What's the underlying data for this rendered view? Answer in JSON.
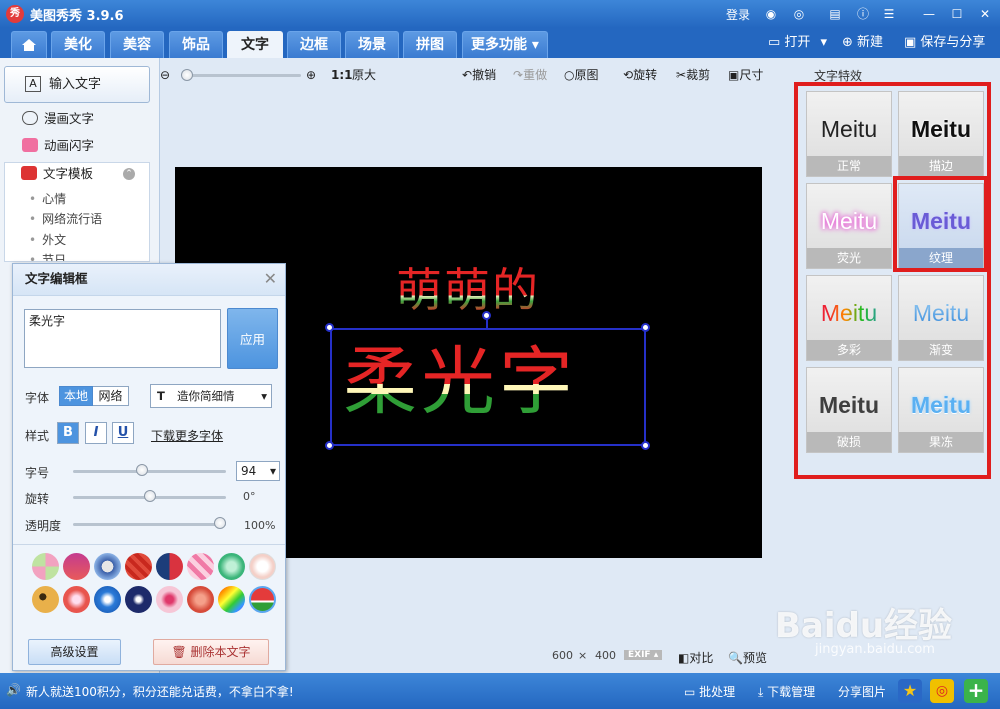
{
  "titlebar": {
    "title": "美图秀秀 3.9.6",
    "login": "登录"
  },
  "tabs": [
    {
      "label": "美化"
    },
    {
      "label": "美容"
    },
    {
      "label": "饰品"
    },
    {
      "label": "文字"
    },
    {
      "label": "边框"
    },
    {
      "label": "场景"
    },
    {
      "label": "拼图"
    },
    {
      "label": "更多功能"
    }
  ],
  "header_actions": {
    "open": "打开",
    "new": "新建",
    "save": "保存与分享"
  },
  "left_panel": {
    "input_text": "输入文字",
    "comic_text": "漫画文字",
    "anim_text": "动画闪字",
    "template": "文字模板",
    "template_items": [
      "心情",
      "网络流行语",
      "外文",
      "节日"
    ]
  },
  "toolbar": {
    "ratio": "1:1",
    "original_size": "原大",
    "undo": "撤销",
    "redo": "重做",
    "original_image": "原图",
    "rotate": "旋转",
    "crop": "裁剪",
    "dimensions": "尺寸"
  },
  "canvas": {
    "line1": "萌萌的",
    "line2": "柔光字"
  },
  "text_editor": {
    "title": "文字编辑框",
    "text_value": "柔光字",
    "apply": "应用",
    "font_label": "字体",
    "font_local": "本地",
    "font_web": "网络",
    "font_selected": "造你简细情",
    "style_label": "样式",
    "bold": "B",
    "italic": "I",
    "underline": "U",
    "more_fonts": "下载更多字体",
    "size_label": "字号",
    "size_value": "94",
    "size_fraction": 0.45,
    "rotate_label": "旋转",
    "rotate_value": "0°",
    "rotate_fraction": 0.5,
    "opacity_label": "透明度",
    "opacity_value": "100%",
    "opacity_fraction": 1.0,
    "advanced": "高级设置",
    "delete": "删除本文字"
  },
  "effects": {
    "title": "文字特效",
    "items": [
      {
        "word": "Meitu",
        "label": "正常"
      },
      {
        "word": "Meitu",
        "label": "描边"
      },
      {
        "word": "Meitu",
        "label": "荧光"
      },
      {
        "word": "Meitu",
        "label": "纹理"
      },
      {
        "word": "Meitu",
        "label": "多彩"
      },
      {
        "word": "Meitu",
        "label": "渐变"
      },
      {
        "word": "Meitu",
        "label": "破损"
      },
      {
        "word": "Meitu",
        "label": "果冻"
      }
    ]
  },
  "bottom_bar": {
    "width": "600",
    "times": "×",
    "height": "400",
    "exif": "EXIF",
    "compare": "对比",
    "preview": "预览"
  },
  "status": {
    "message": "新人就送100积分，积分还能兑话费，不拿白不拿!",
    "batch": "批处理",
    "download": "下载管理",
    "share": "分享图片"
  },
  "watermark": {
    "brand": "Baidu经验",
    "url": "jingyan.baidu.com"
  },
  "colors": {
    "accent": "#2467c0",
    "highlight": "#e01d1d",
    "selection": "#2530c9"
  }
}
